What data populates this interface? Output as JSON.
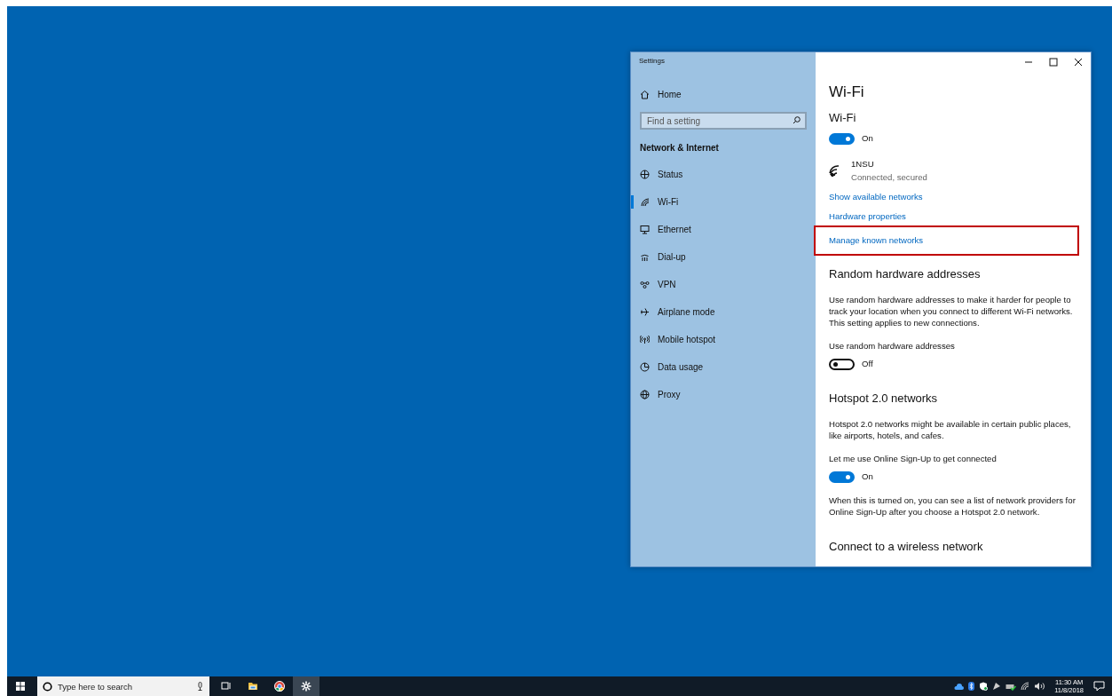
{
  "window": {
    "title": "Settings"
  },
  "sidebar": {
    "home": "Home",
    "search": {
      "placeholder": "Find a setting"
    },
    "section": "Network & Internet",
    "items": [
      {
        "label": "Status",
        "kind": "status",
        "selected": false
      },
      {
        "label": "Wi-Fi",
        "kind": "wifi",
        "selected": true
      },
      {
        "label": "Ethernet",
        "kind": "ethernet",
        "selected": false
      },
      {
        "label": "Dial-up",
        "kind": "dialup",
        "selected": false
      },
      {
        "label": "VPN",
        "kind": "vpn",
        "selected": false
      },
      {
        "label": "Airplane mode",
        "kind": "airplane",
        "selected": false
      },
      {
        "label": "Mobile hotspot",
        "kind": "hotspot",
        "selected": false
      },
      {
        "label": "Data usage",
        "kind": "data",
        "selected": false
      },
      {
        "label": "Proxy",
        "kind": "proxy",
        "selected": false
      }
    ]
  },
  "content": {
    "title": "Wi-Fi",
    "blocks": [
      {
        "kind": "subheading",
        "text": "Wi-Fi"
      },
      {
        "kind": "toggle",
        "on": true,
        "state_text": "On"
      },
      {
        "kind": "network",
        "name": "1NSU",
        "status": "Connected, secured"
      },
      {
        "kind": "link",
        "text": "Show available networks",
        "highlighted": false
      },
      {
        "kind": "link",
        "text": "Hardware properties",
        "highlighted": false
      },
      {
        "kind": "link",
        "text": "Manage known networks",
        "highlighted": true
      },
      {
        "kind": "heading",
        "text": "Random hardware addresses"
      },
      {
        "kind": "paragraph",
        "text": "Use random hardware addresses to make it harder for people to track your location when you connect to different Wi-Fi networks. This setting applies to new connections."
      },
      {
        "kind": "label",
        "text": "Use random hardware addresses"
      },
      {
        "kind": "toggle",
        "on": false,
        "state_text": "Off"
      },
      {
        "kind": "heading",
        "text": "Hotspot 2.0 networks"
      },
      {
        "kind": "paragraph",
        "text": "Hotspot 2.0 networks might be available in certain public places, like airports, hotels, and cafes."
      },
      {
        "kind": "label",
        "text": "Let me use Online Sign-Up to get connected"
      },
      {
        "kind": "toggle",
        "on": true,
        "state_text": "On"
      },
      {
        "kind": "paragraph",
        "text": "When this is turned on, you can see a list of network providers for Online Sign-Up after you choose a Hotspot 2.0 network."
      },
      {
        "kind": "heading",
        "text": "Connect to a wireless network"
      }
    ]
  },
  "taskbar": {
    "search": {
      "placeholder": "Type here to search"
    },
    "apps": [
      {
        "kind": "taskview",
        "active": false
      },
      {
        "kind": "explorer",
        "active": false
      },
      {
        "kind": "browser",
        "active": false
      },
      {
        "kind": "settings",
        "active": true
      }
    ],
    "time": "11:30 AM",
    "date": "11/8/2018"
  }
}
